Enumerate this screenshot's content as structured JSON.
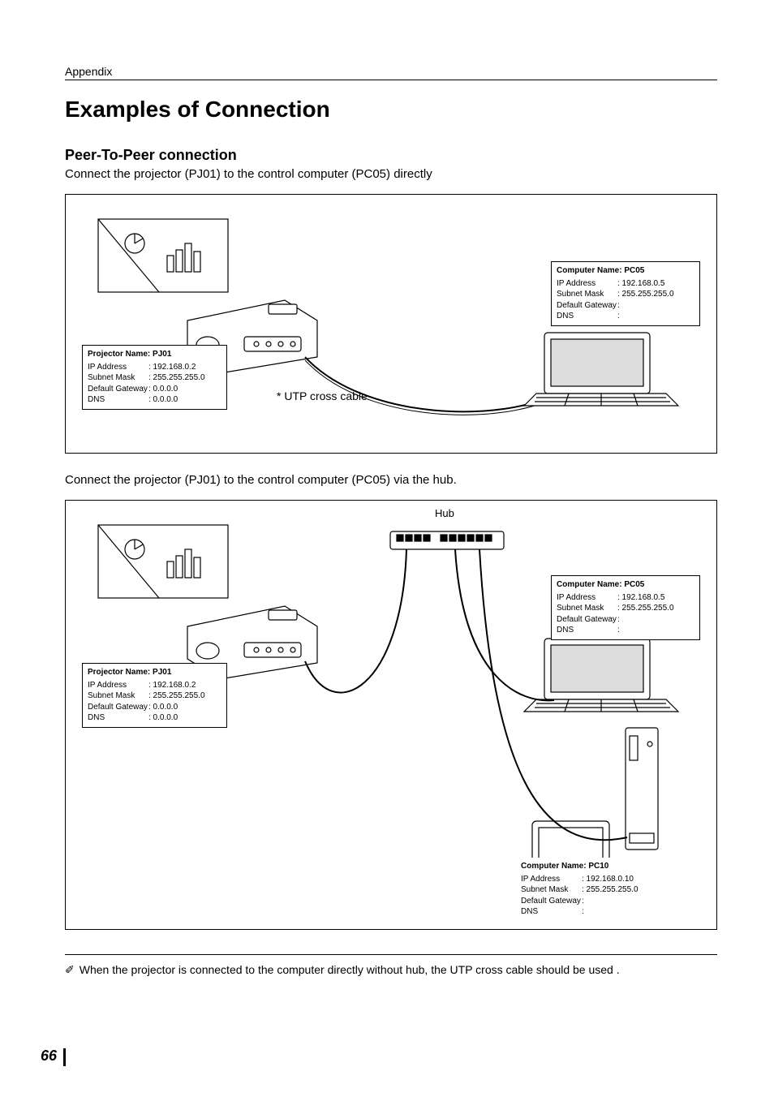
{
  "header": {
    "section": "Appendix"
  },
  "title": "Examples of Connection",
  "section1": {
    "heading": "Peer-To-Peer  connection",
    "intro": "Connect the projector (PJ01) to the control computer (PC05) directly"
  },
  "diagram1": {
    "cable_label": "* UTP cross cable",
    "projector": {
      "title": "Projector Name: PJ01",
      "ip_label": "IP Address",
      "ip": ": 192.168.0.2",
      "mask_label": "Subnet Mask",
      "mask": ": 255.255.255.0",
      "gw_label": "Default Gateway",
      "gw": ": 0.0.0.0",
      "dns_label": "DNS",
      "dns": ": 0.0.0.0"
    },
    "computer": {
      "title": "Computer Name: PC05",
      "ip_label": "IP Address",
      "ip": ": 192.168.0.5",
      "mask_label": "Subnet Mask",
      "mask": ": 255.255.255.0",
      "gw_label": "Default Gateway",
      "gw": ":",
      "dns_label": "DNS",
      "dns": ":"
    }
  },
  "section2": {
    "intro": "Connect the projector (PJ01) to the control computer (PC05) via the hub."
  },
  "diagram2": {
    "hub_label": "Hub",
    "projector": {
      "title": "Projector Name: PJ01",
      "ip_label": "IP Address",
      "ip": ": 192.168.0.2",
      "mask_label": "Subnet Mask",
      "mask": ": 255.255.255.0",
      "gw_label": "Default Gateway",
      "gw": ": 0.0.0.0",
      "dns_label": "DNS",
      "dns": ": 0.0.0.0"
    },
    "computer05": {
      "title": "Computer Name: PC05",
      "ip_label": "IP Address",
      "ip": ": 192.168.0.5",
      "mask_label": "Subnet Mask",
      "mask": ": 255.255.255.0",
      "gw_label": "Default Gateway",
      "gw": ":",
      "dns_label": "DNS",
      "dns": ":"
    },
    "computer10": {
      "title": "Computer Name: PC10",
      "ip_label": "IP Address",
      "ip": ": 192.168.0.10",
      "mask_label": "Subnet Mask",
      "mask": ": 255.255.255.0",
      "gw_label": "Default Gateway",
      "gw": ":",
      "dns_label": "DNS",
      "dns": ":"
    }
  },
  "footnote": {
    "icon": "✐",
    "text": "When the projector is connected to the computer directly without hub, the UTP cross cable should be used ."
  },
  "page_number": "66"
}
